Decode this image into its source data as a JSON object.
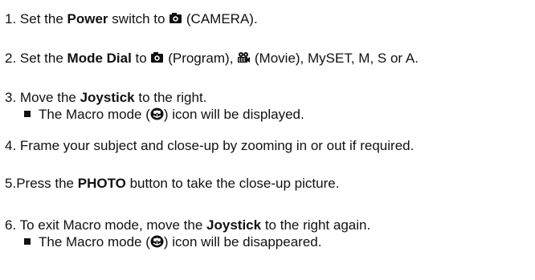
{
  "steps": [
    {
      "number": "1.",
      "parts": [
        "Set the ",
        "Power",
        " switch to ",
        "(CAMERA)."
      ]
    },
    {
      "number": "2.",
      "parts": [
        "Set the ",
        "Mode Dial",
        " to ",
        "(Program), ",
        "(Movie), MySET, M, S or A."
      ]
    },
    {
      "number": "3.",
      "parts": [
        "Move the ",
        "Joystick",
        " to the right."
      ],
      "sub": [
        "The Macro mode (",
        ") icon will be displayed."
      ]
    },
    {
      "number": "4.",
      "text": "Frame your subject and close-up by zooming in or out if required."
    },
    {
      "number": "5.",
      "parts": [
        "Press the ",
        "PHOTO",
        " button to take the close-up picture."
      ]
    },
    {
      "number": "6.",
      "parts": [
        "To exit Macro mode, move the ",
        "Joystick",
        " to the right again."
      ],
      "sub": [
        "The Macro mode (",
        ") icon will be disappeared."
      ]
    }
  ],
  "icons": {
    "camera": "camera-icon",
    "movie": "movie-icon",
    "macro": "macro-flower-icon"
  }
}
